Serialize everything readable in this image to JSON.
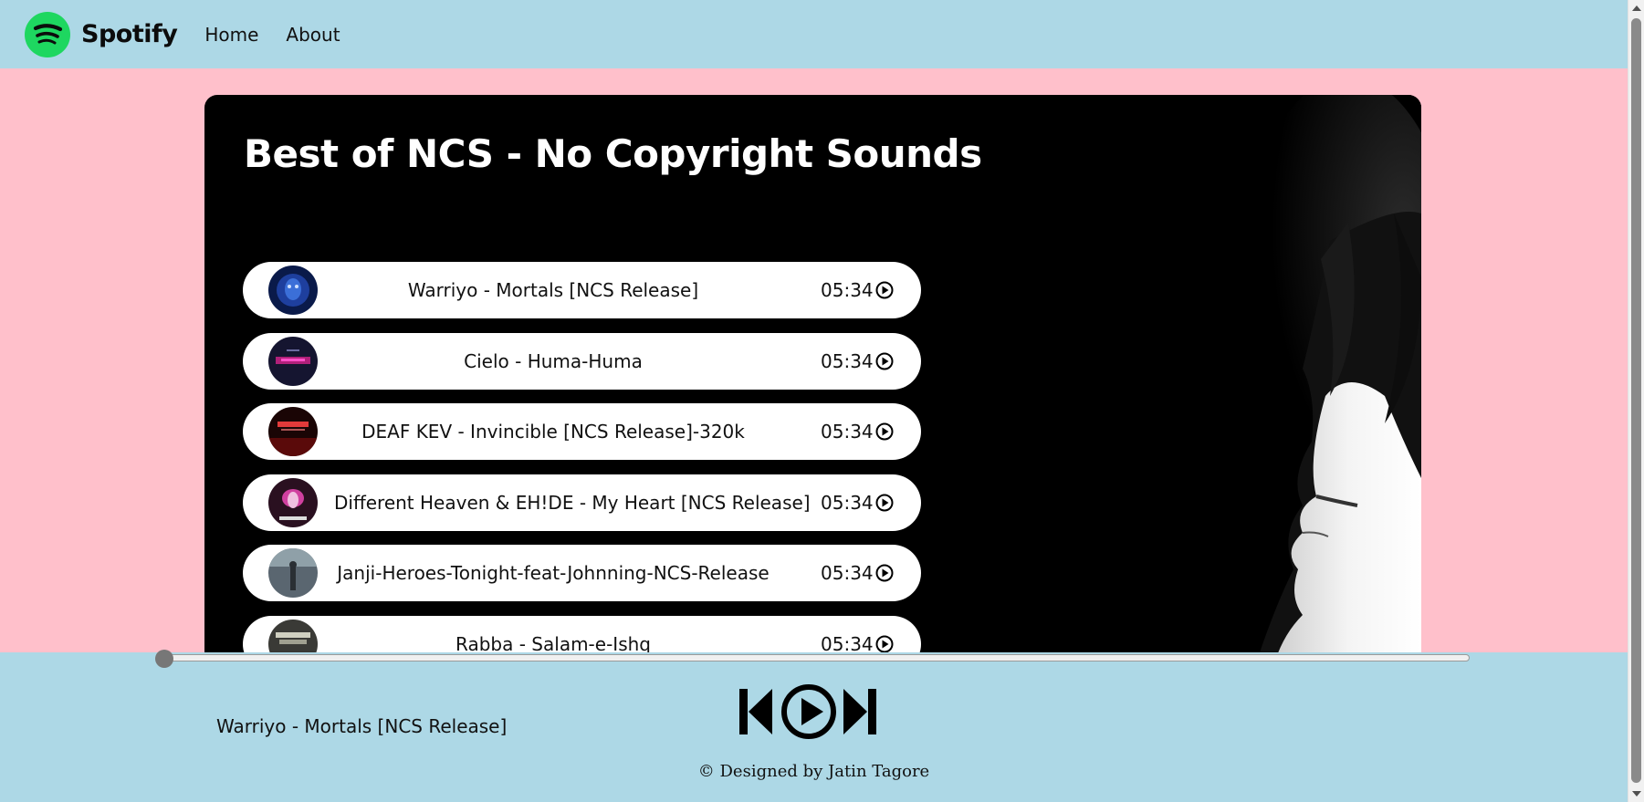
{
  "nav": {
    "brand": "Spotify",
    "links": [
      "Home",
      "About"
    ],
    "logo_color": "#1ed760"
  },
  "playlist": {
    "title": "Best of NCS - No Copyright Sounds",
    "songs": [
      {
        "name": "Warriyo - Mortals [NCS Release]",
        "duration": "05:34"
      },
      {
        "name": "Cielo - Huma-Huma",
        "duration": "05:34"
      },
      {
        "name": "DEAF KEV - Invincible [NCS Release]-320k",
        "duration": "05:34"
      },
      {
        "name": "Different Heaven & EH!DE - My Heart [NCS Release]",
        "duration": "05:34"
      },
      {
        "name": "Janji-Heroes-Tonight-feat-Johnning-NCS-Release",
        "duration": "05:34"
      },
      {
        "name": "Rabba - Salam-e-Ishq",
        "duration": "05:34"
      }
    ]
  },
  "player": {
    "now_playing": "Warriyo - Mortals [NCS Release]",
    "progress": 0
  },
  "footer": {
    "text": "© Designed by Jatin Tagore"
  },
  "colors": {
    "nav_bg": "#add8e6",
    "page_bg": "#ffc0cb",
    "container_bg": "#000000"
  }
}
